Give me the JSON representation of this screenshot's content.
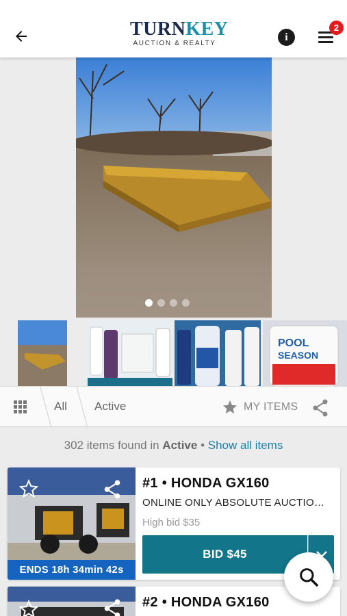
{
  "header": {
    "logo_main_1": "TURN",
    "logo_main_2": "KEY",
    "logo_sub": "AUCTION & REALTY",
    "menu_badge": "2"
  },
  "gallery": {
    "photo_count": 4,
    "active_index": 0
  },
  "filter_bar": {
    "tab_all": "All",
    "tab_active": "Active",
    "my_items": "MY ITEMS"
  },
  "results": {
    "count_text": "302 items found in",
    "filter_name": "Active",
    "separator": "•",
    "show_all": "Show all items"
  },
  "lots": [
    {
      "title": "#1 • HONDA GX160",
      "subtitle": "ONLINE ONLY ABSOLUTE AUCTION ...",
      "high_bid": "High bid $35",
      "bid_label": "BID $45",
      "ends": "ENDS 18h 34min 42s"
    },
    {
      "title": "#2 • HONDA GX160"
    }
  ],
  "colors": {
    "accent": "#12758a",
    "ends_bar": "#1565c0",
    "badge": "#e21c1c",
    "link": "#1f7fa3"
  },
  "icons": [
    "back-arrow-icon",
    "info-icon",
    "hamburger-menu-icon",
    "grid-icon",
    "star-icon",
    "share-icon",
    "chevron-down-icon",
    "search-icon"
  ]
}
